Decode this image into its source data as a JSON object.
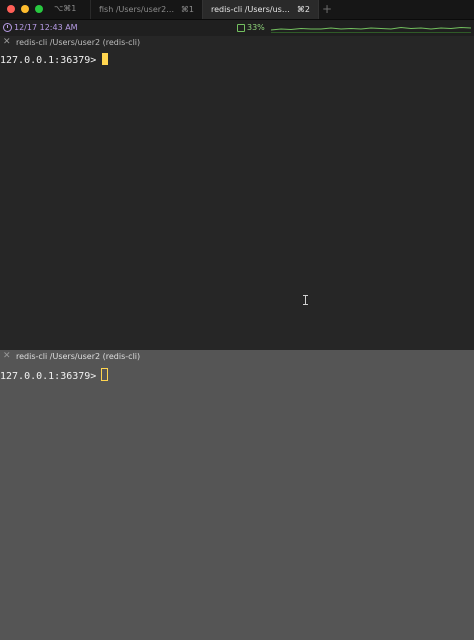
{
  "window_shortcut": "⌥⌘1",
  "tabs": [
    {
      "title": "fish /Users/user2/cod...",
      "shortcut": "⌘1"
    },
    {
      "title": "redis-cli /Users/user2/...",
      "shortcut": "⌘2"
    }
  ],
  "new_tab_label": "+",
  "status": {
    "datetime": "12/17 12:43 AM",
    "cpu": "33%"
  },
  "panes": [
    {
      "title": "redis-cli /Users/user2 (redis-cli)",
      "prompt": "127.0.0.1:36379>"
    },
    {
      "title": "redis-cli /Users/user2 (redis-cli)",
      "prompt": "127.0.0.1:36379>"
    }
  ],
  "colors": {
    "accent_purple": "#b79ce6",
    "cpu_green": "#73c05f",
    "cursor": "#ffd54f"
  },
  "icons": [
    "clock-icon",
    "cpu-icon",
    "close-icon"
  ]
}
